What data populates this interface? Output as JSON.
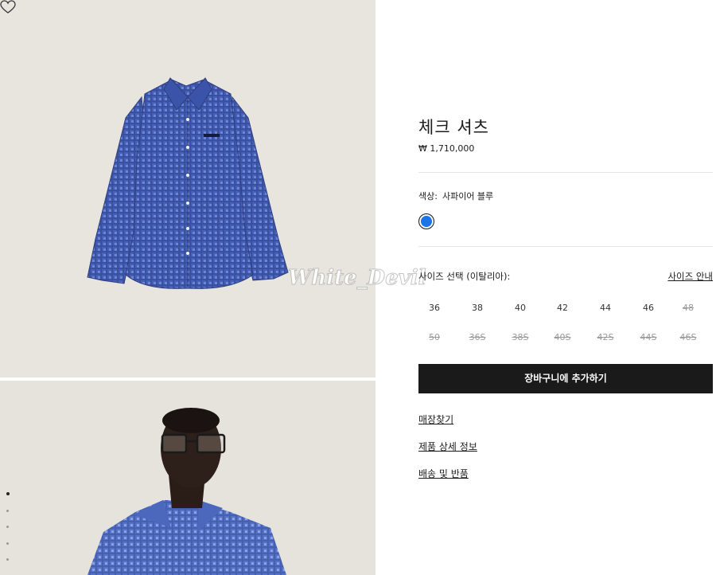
{
  "product": {
    "title": "체크 셔츠",
    "price": "₩ 1,710,000"
  },
  "color": {
    "label": "색상:",
    "value": "사파이어 블루",
    "swatch_hex": "#1b74e8"
  },
  "size": {
    "label": "사이즈 선택 (이탈리아):",
    "guide_link": "사이즈 안내",
    "options": [
      {
        "label": "36",
        "available": true
      },
      {
        "label": "38",
        "available": true
      },
      {
        "label": "40",
        "available": true
      },
      {
        "label": "42",
        "available": true
      },
      {
        "label": "44",
        "available": true
      },
      {
        "label": "46",
        "available": true
      },
      {
        "label": "48",
        "available": false
      },
      {
        "label": "50",
        "available": false
      },
      {
        "label": "36S",
        "available": false
      },
      {
        "label": "38S",
        "available": false
      },
      {
        "label": "40S",
        "available": false
      },
      {
        "label": "42S",
        "available": false
      },
      {
        "label": "44S",
        "available": false
      },
      {
        "label": "46S",
        "available": false
      }
    ]
  },
  "actions": {
    "add_to_cart": "장바구니에 추가하기"
  },
  "links": {
    "store_finder": "매장찾기",
    "product_details": "제품 상세 정보",
    "shipping_returns": "배송 및 반품"
  },
  "gallery": {
    "watermark": "White_Devil",
    "wishlist_icon": "heart-icon",
    "dot_count": 5,
    "active_dot": 0
  }
}
